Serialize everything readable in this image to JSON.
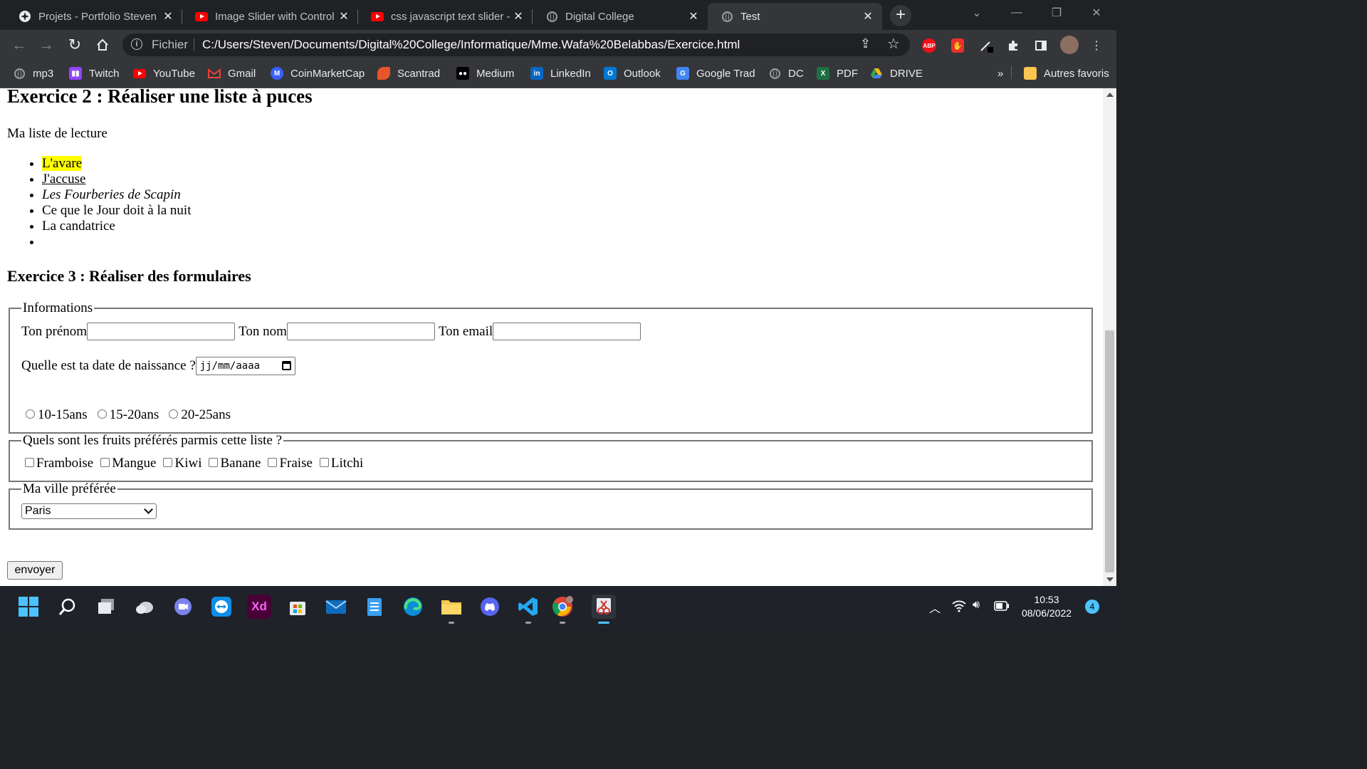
{
  "tabs": [
    {
      "title": "Projets - Portfolio Steven",
      "icon": "portfolio-icon",
      "active": false
    },
    {
      "title": "Image Slider with Control",
      "icon": "youtube-icon",
      "active": false
    },
    {
      "title": "css javascript text slider -",
      "icon": "youtube-icon",
      "active": false
    },
    {
      "title": "Digital College",
      "icon": "globe-icon",
      "active": false
    },
    {
      "title": "Test",
      "icon": "globe-icon",
      "active": true
    }
  ],
  "address": {
    "scheme_label": "Fichier",
    "url": "C:/Users/Steven/Documents/Digital%20College/Informatique/Mme.Wafa%20Belabbas/Exercice.html"
  },
  "extensions": {
    "abp_label": "ABP"
  },
  "bookmarks": [
    {
      "label": "mp3",
      "icon": "globe-icon",
      "color": "#9aa0a6"
    },
    {
      "label": "Twitch",
      "icon": "twitch-icon",
      "color": "#9146ff"
    },
    {
      "label": "YouTube",
      "icon": "youtube-icon",
      "color": "#ff0000"
    },
    {
      "label": "Gmail",
      "icon": "gmail-icon",
      "color": "#ea4335"
    },
    {
      "label": "CoinMarketCap",
      "icon": "coinmarketcap-icon",
      "color": "#3861fb"
    },
    {
      "label": "Scantrad",
      "icon": "scantrad-icon",
      "color": "#e8552a"
    },
    {
      "label": "Medium",
      "icon": "medium-icon",
      "color": "#000000"
    },
    {
      "label": "LinkedIn",
      "icon": "linkedin-icon",
      "color": "#0a66c2"
    },
    {
      "label": "Outlook",
      "icon": "outlook-icon",
      "color": "#0078d4"
    },
    {
      "label": "Google Trad",
      "icon": "google-translate-icon",
      "color": "#4285f4"
    },
    {
      "label": "DC",
      "icon": "globe-icon",
      "color": "#9aa0a6"
    },
    {
      "label": "PDF",
      "icon": "excel-icon",
      "color": "#1d6f42"
    },
    {
      "label": "DRIVE",
      "icon": "google-drive-icon",
      "color": "#fbbc04"
    }
  ],
  "bookmarks_overflow": "»",
  "other_bookmarks": "Autres favoris",
  "page": {
    "ex2_title": "Exercice 2 : Réaliser une liste à puces",
    "reading_label": "Ma liste de lecture",
    "list_items": [
      "L'avare",
      "J'accuse",
      "Les Fourberies de Scapin",
      "Ce que le Jour doit à la nuit",
      "La candatrice",
      ""
    ],
    "ex3_title": "Exercice 3 : Réaliser des formulaires",
    "fieldset_info": {
      "legend": "Informations",
      "firstname_label": "Ton prénom",
      "lastname_label": "Ton nom",
      "email_label": "Ton email",
      "birth_label": "Quelle est ta date de naissance ?",
      "date_placeholder": "jj/mm/aaaa",
      "age_options": [
        "10-15ans",
        "15-20ans",
        "20-25ans"
      ]
    },
    "fieldset_fruits": {
      "legend": "Quels sont les fruits préférés parmis cette liste ?",
      "options": [
        "Framboise",
        "Mangue",
        "Kiwi",
        "Banane",
        "Fraise",
        "Litchi"
      ]
    },
    "fieldset_city": {
      "legend": "Ma ville préférée",
      "selected": "Paris"
    },
    "submit_label": "envoyer"
  },
  "taskbar": {
    "apps": [
      "start-icon",
      "search-icon",
      "task-view-icon",
      "widgets-icon",
      "teams-chat-icon",
      "teamviewer-icon",
      "adobe-xd-icon",
      "microsoft-store-icon",
      "mail-icon",
      "notepad-icon",
      "edge-icon",
      "file-explorer-icon",
      "discord-icon",
      "vscode-icon",
      "chrome-icon",
      "snipping-tool-icon"
    ],
    "xd_label": "Xd",
    "time": "10:53",
    "date": "08/06/2022",
    "notifications": "4"
  },
  "colors": {
    "highlight": "#ffff00",
    "browser_dark": "#202124",
    "browser_toolbar": "#35363a",
    "taskbar": "#1f2229",
    "accent": "#4cc2ff"
  }
}
